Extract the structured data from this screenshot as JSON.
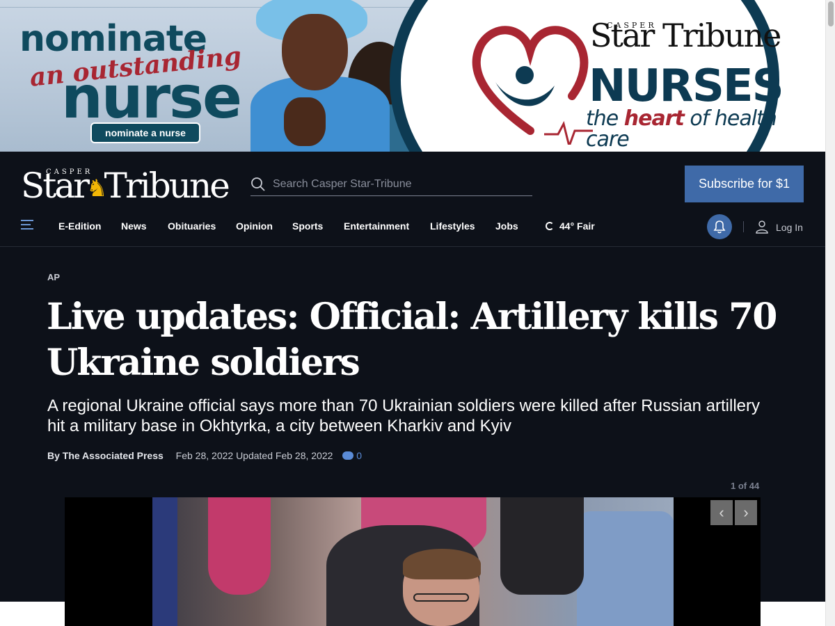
{
  "ad": {
    "line1": "nominate",
    "line2": "an outstanding",
    "line3": "nurse",
    "button": "nominate a nurse",
    "brand_casper": "CASPER",
    "brand": "Star Tribune",
    "nurses": "NURSES",
    "tagline_pre": "the ",
    "tagline_bold": "heart",
    "tagline_post": " of health care"
  },
  "header": {
    "logo_casper": "CASPER",
    "logo_left": "Star",
    "logo_right": "Tribune",
    "search_placeholder": "Search Casper Star-Tribune",
    "subscribe": "Subscribe for $1"
  },
  "nav": {
    "items": [
      "E-Edition",
      "News",
      "Obituaries",
      "Opinion",
      "Sports",
      "Entertainment",
      "Lifestyles",
      "Jobs"
    ],
    "weather": "44° Fair",
    "login": "Log In"
  },
  "article": {
    "section": "AP",
    "headline": "Live updates: Official: Artillery kills 70 Ukraine soldiers",
    "subhead": "A regional Ukraine official says more than 70 Ukrainian soldiers were killed after Russian artillery hit a military base in Okhtyrka, a city between Kharkiv and Kyiv",
    "author": "By The Associated Press",
    "dates": "Feb 28, 2022 Updated Feb 28, 2022",
    "comments": "0",
    "counter": "1 of 44"
  },
  "gallery": {
    "prev": "‹",
    "next": "›"
  },
  "colors": {
    "header_bg": "#0d1119",
    "accent_blue": "#3f6aa8",
    "ad_navy": "#0d3a52",
    "ad_red": "#a82632"
  },
  "icons": [
    "search-icon",
    "menu-icon",
    "weather-icon",
    "bell-icon",
    "user-icon",
    "comment-icon"
  ]
}
